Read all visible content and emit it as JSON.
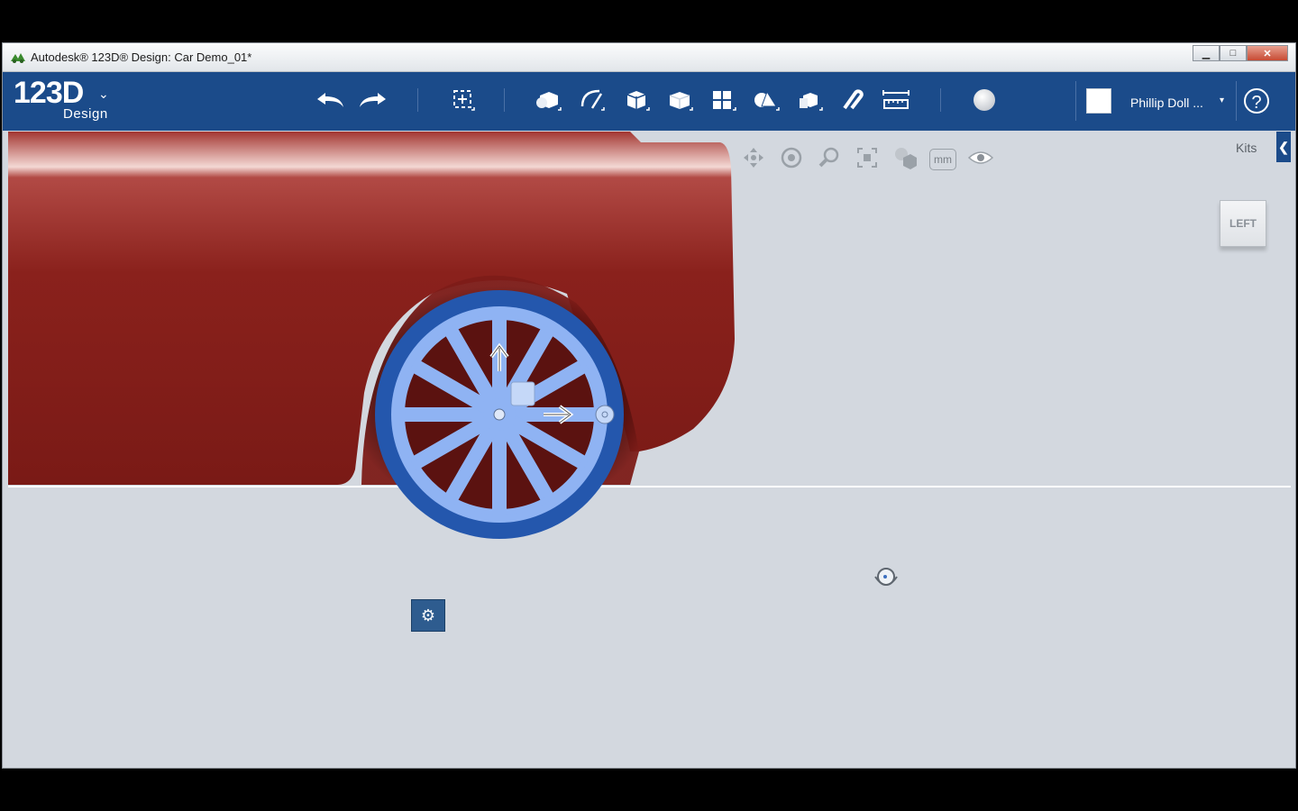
{
  "window": {
    "title": "Autodesk® 123D® Design: Car Demo_01*",
    "controls": {
      "minimize": "▁",
      "maximize": "□",
      "close": "✕"
    }
  },
  "app": {
    "logo_main": "123D",
    "logo_sub": "Design",
    "logo_menu_chevron": "⌄"
  },
  "toolbar": {
    "tools": [
      "undo-icon",
      "redo-icon",
      "transform-icon",
      "primitives-icon",
      "sketch-icon",
      "construct-icon",
      "modify-icon",
      "pattern-icon",
      "grouping-icon",
      "combine-icon",
      "snap-icon",
      "measure-icon",
      "material-icon"
    ]
  },
  "user": {
    "name": "Phillip Doll ...",
    "dropdown": "▾",
    "help": "?"
  },
  "viewport": {
    "units": "mm",
    "kits_label": "Kits",
    "kits_toggle": "❮",
    "viewcube_face": "LEFT",
    "settings_glyph": "⚙"
  },
  "colors": {
    "toolbar_bg": "#1b4b8a",
    "car_body": "#8b201c",
    "wheel_selected": "#8fb3f3",
    "wheel_rim": "#2457ad",
    "viewport_bg": "#d3d8df"
  }
}
